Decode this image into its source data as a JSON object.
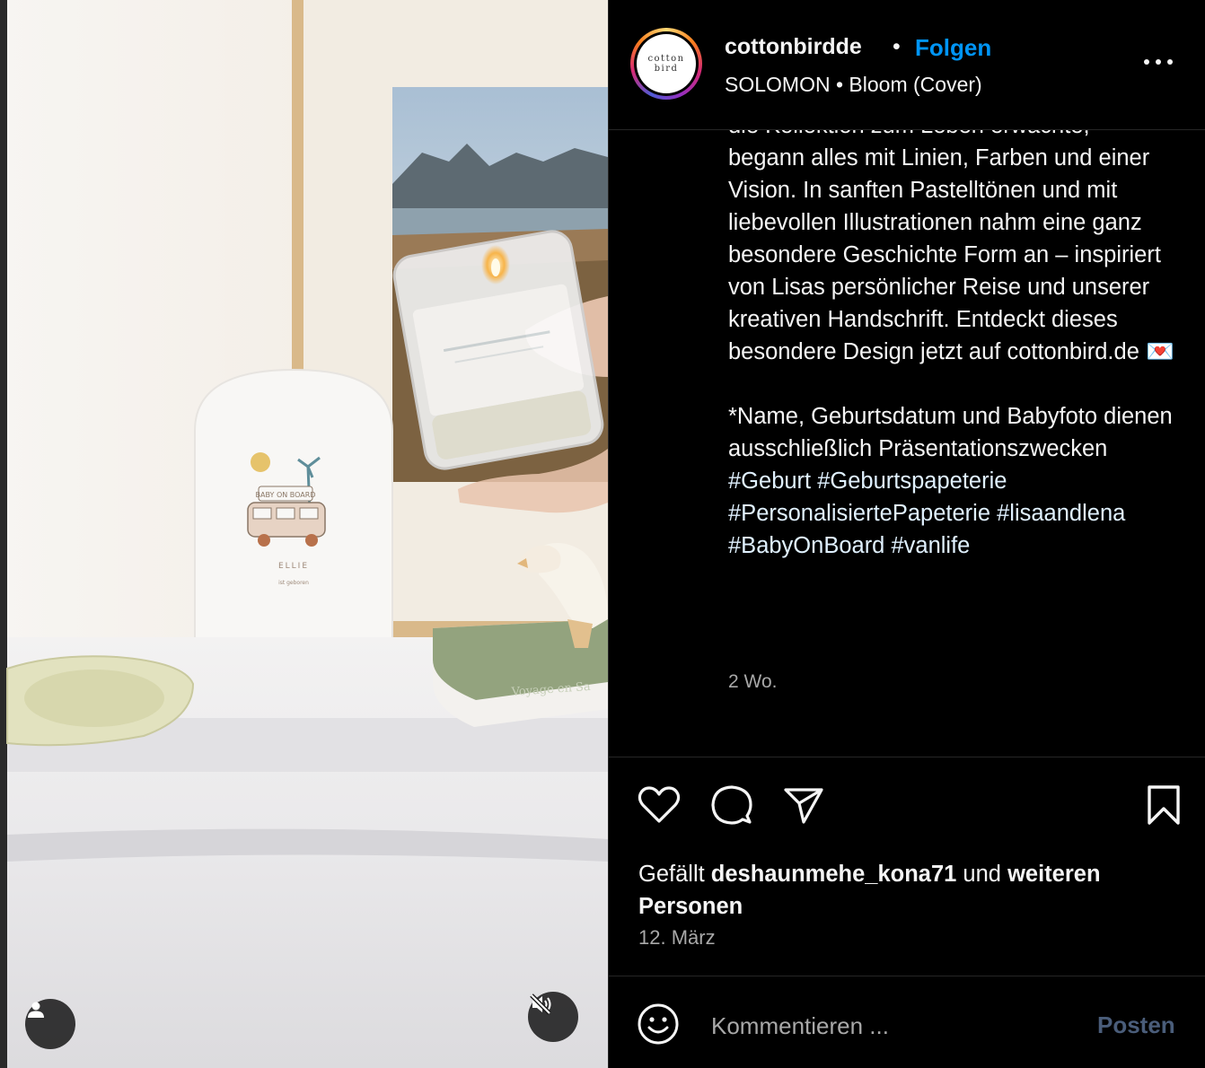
{
  "post": {
    "account": {
      "username": "cottonbirdde",
      "avatar_text_line1": "cotton",
      "avatar_text_line2": "bird",
      "follow_label": "Folgen",
      "separator": "•"
    },
    "audio": {
      "artist": "SOLOMON",
      "separator": "•",
      "track": "Bloom (Cover)"
    },
    "media": {
      "user_tag_icon": "user-icon",
      "mute_icon": "speaker-muted-icon",
      "card_text_name": "ELLIE",
      "card_text_sub": "ist geboren",
      "card_text_van": "BABY ON BOARD",
      "book_spine_text": "Voyage en Sa"
    },
    "caption": {
      "line_partial": "die Kollektion zum Leben erwachte,",
      "text": "begann alles mit Linien, Farben und einer Vision. In sanften Pastelltönen und mit liebevollen Illustrationen nahm eine ganz besondere Geschichte Form an – inspiriert von Lisas persönlicher Reise und unserer kreativen Handschrift. Entdeckt dieses besondere Design jetzt auf cottonbird.de 💌",
      "note": "*Name, Geburtsdatum und Babyfoto dienen ausschließlich Präsentationszwecken",
      "hashtags": [
        "#Geburt",
        "#Geburtspapeterie",
        "#PersonalisiertePapeterie",
        "#lisaandlena",
        "#BabyOnBoard",
        "#vanlife"
      ],
      "time_ago": "2 Wo."
    },
    "actions": {
      "like_icon": "heart-icon",
      "comment_icon": "comment-icon",
      "share_icon": "paper-plane-icon",
      "save_icon": "bookmark-icon"
    },
    "likes": {
      "prefix": "Gefällt",
      "user": "deshaunmehe_kona71",
      "middle": "und",
      "suffix": "weiteren Personen"
    },
    "date": "12. März",
    "comment": {
      "emoji_icon": "smiley-icon",
      "placeholder": "Kommentieren ...",
      "post_label": "Posten"
    },
    "colors": {
      "accent": "#0095f6",
      "background": "#000000",
      "muted_text": "#a8a8a8",
      "disabled_post": "#4a5d7a"
    }
  }
}
